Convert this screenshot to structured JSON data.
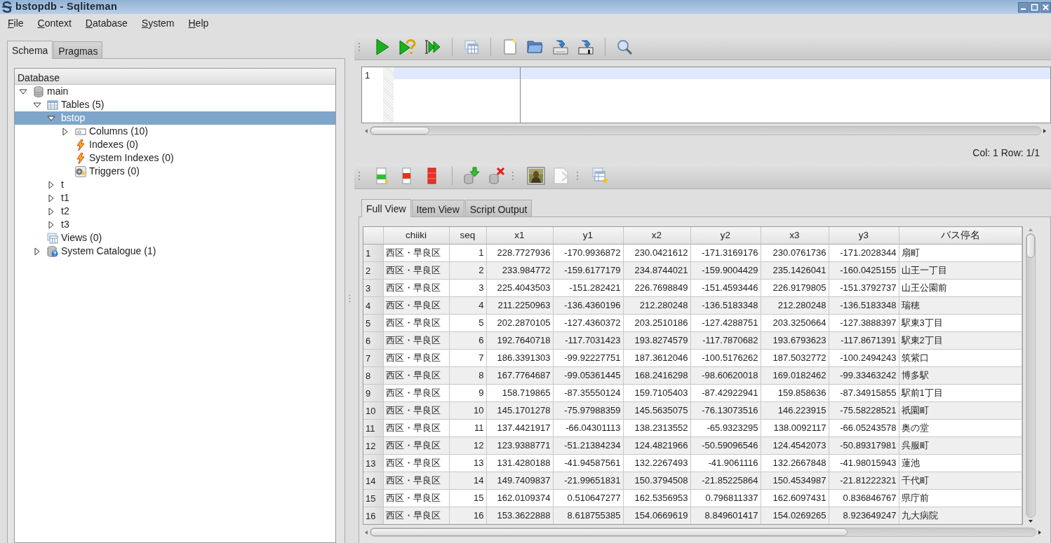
{
  "window": {
    "title": "bstopdb - Sqliteman"
  },
  "menu": [
    "File",
    "Context",
    "Database",
    "System",
    "Help"
  ],
  "left_tabs": [
    {
      "label": "Schema",
      "selected": true
    },
    {
      "label": "Pragmas",
      "selected": false
    }
  ],
  "tree": {
    "header": "Database",
    "items": [
      {
        "label": "main",
        "kind": "database",
        "expanded": true,
        "selected": false,
        "children": [
          {
            "label": "Tables (5)",
            "kind": "tables",
            "expanded": true,
            "selected": false,
            "children": [
              {
                "label": "bstop",
                "expanded": true,
                "selected": true,
                "children": [
                  {
                    "label": "Columns (10)",
                    "kind": "columns",
                    "expanded": false,
                    "selected": false
                  },
                  {
                    "label": "Indexes (0)",
                    "kind": "index",
                    "selected": false
                  },
                  {
                    "label": "System Indexes (0)",
                    "kind": "index",
                    "selected": false
                  },
                  {
                    "label": "Triggers (0)",
                    "kind": "trigger",
                    "selected": false
                  }
                ]
              },
              {
                "label": "t",
                "expanded": false,
                "selected": false
              },
              {
                "label": "t1",
                "expanded": false,
                "selected": false
              },
              {
                "label": "t2",
                "expanded": false,
                "selected": false
              },
              {
                "label": "t3",
                "expanded": false,
                "selected": false
              }
            ]
          },
          {
            "label": "Views (0)",
            "kind": "views",
            "selected": false
          },
          {
            "label": "System Catalogue (1)",
            "kind": "catalogue",
            "expanded": false,
            "selected": false
          }
        ]
      }
    ]
  },
  "editor": {
    "line_number": "1"
  },
  "status": "Col: 1 Row: 1/1",
  "result_tabs": [
    {
      "label": "Full View",
      "selected": true
    },
    {
      "label": "Item View",
      "selected": false
    },
    {
      "label": "Script Output",
      "selected": false
    }
  ],
  "table": {
    "columns": [
      {
        "label": "chiiki",
        "kind": "text"
      },
      {
        "label": "seq",
        "kind": "number"
      },
      {
        "label": "x1",
        "kind": "number"
      },
      {
        "label": "y1",
        "kind": "number"
      },
      {
        "label": "x2",
        "kind": "number"
      },
      {
        "label": "y2",
        "kind": "number"
      },
      {
        "label": "x3",
        "kind": "number"
      },
      {
        "label": "y3",
        "kind": "number"
      },
      {
        "label": "バス停名",
        "kind": "text"
      }
    ],
    "rows": [
      {
        "number": "1",
        "cells": [
          "西区・早良区",
          "1",
          "228.7727936",
          "-170.9936872",
          "230.0421612",
          "-171.3169176",
          "230.0761736",
          "-171.2028344",
          "扇町"
        ]
      },
      {
        "number": "2",
        "cells": [
          "西区・早良区",
          "2",
          "233.984772",
          "-159.6177179",
          "234.8744021",
          "-159.9004429",
          "235.1426041",
          "-160.0425155",
          "山王一丁目"
        ]
      },
      {
        "number": "3",
        "cells": [
          "西区・早良区",
          "3",
          "225.4043503",
          "-151.282421",
          "226.7698849",
          "-151.4593446",
          "226.9179805",
          "-151.3792737",
          "山王公園前"
        ]
      },
      {
        "number": "4",
        "cells": [
          "西区・早良区",
          "4",
          "211.2250963",
          "-136.4360196",
          "212.280248",
          "-136.5183348",
          "212.280248",
          "-136.5183348",
          "瑞穂"
        ]
      },
      {
        "number": "5",
        "cells": [
          "西区・早良区",
          "5",
          "202.2870105",
          "-127.4360372",
          "203.2510186",
          "-127.4288751",
          "203.3250664",
          "-127.3888397",
          "駅東3丁目"
        ]
      },
      {
        "number": "6",
        "cells": [
          "西区・早良区",
          "6",
          "192.7640718",
          "-117.7031423",
          "193.8274579",
          "-117.7870682",
          "193.6793623",
          "-117.8671391",
          "駅東2丁目"
        ]
      },
      {
        "number": "7",
        "cells": [
          "西区・早良区",
          "7",
          "186.3391303",
          "-99.92227751",
          "187.3612046",
          "-100.5176262",
          "187.5032772",
          "-100.2494243",
          "筑紫口"
        ]
      },
      {
        "number": "8",
        "cells": [
          "西区・早良区",
          "8",
          "167.7764687",
          "-99.05361445",
          "168.2416298",
          "-98.60620018",
          "169.0182462",
          "-99.33463242",
          "博多駅"
        ]
      },
      {
        "number": "9",
        "cells": [
          "西区・早良区",
          "9",
          "158.719865",
          "-87.35550124",
          "159.7105403",
          "-87.42922941",
          "159.858636",
          "-87.34915855",
          "駅前1丁目"
        ]
      },
      {
        "number": "10",
        "cells": [
          "西区・早良区",
          "10",
          "145.1701278",
          "-75.97988359",
          "145.5635075",
          "-76.13073516",
          "146.223915",
          "-75.58228521",
          "祇園町"
        ]
      },
      {
        "number": "11",
        "cells": [
          "西区・早良区",
          "11",
          "137.4421917",
          "-66.04301113",
          "138.2313552",
          "-65.9323295",
          "138.0092117",
          "-66.05243578",
          "奥の堂"
        ]
      },
      {
        "number": "12",
        "cells": [
          "西区・早良区",
          "12",
          "123.9388771",
          "-51.21384234",
          "124.4821966",
          "-50.59096546",
          "124.4542073",
          "-50.89317981",
          "呉服町"
        ]
      },
      {
        "number": "13",
        "cells": [
          "西区・早良区",
          "13",
          "131.4280188",
          "-41.94587561",
          "132.2267493",
          "-41.9061116",
          "132.2667848",
          "-41.98015943",
          "蓮池"
        ]
      },
      {
        "number": "14",
        "cells": [
          "西区・早良区",
          "14",
          "149.7409837",
          "-21.99651831",
          "150.3794508",
          "-21.85225864",
          "150.4534987",
          "-21.81222321",
          "千代町"
        ]
      },
      {
        "number": "15",
        "cells": [
          "西区・早良区",
          "15",
          "162.0109374",
          "0.510647277",
          "162.5356953",
          "0.796811337",
          "162.6097431",
          "0.836846767",
          "県庁前"
        ]
      },
      {
        "number": "16",
        "cells": [
          "西区・早良区",
          "16",
          "153.3622888",
          "8.618755385",
          "154.0669619",
          "8.849601417",
          "154.0269265",
          "8.923649247",
          "九大病院"
        ]
      }
    ]
  }
}
